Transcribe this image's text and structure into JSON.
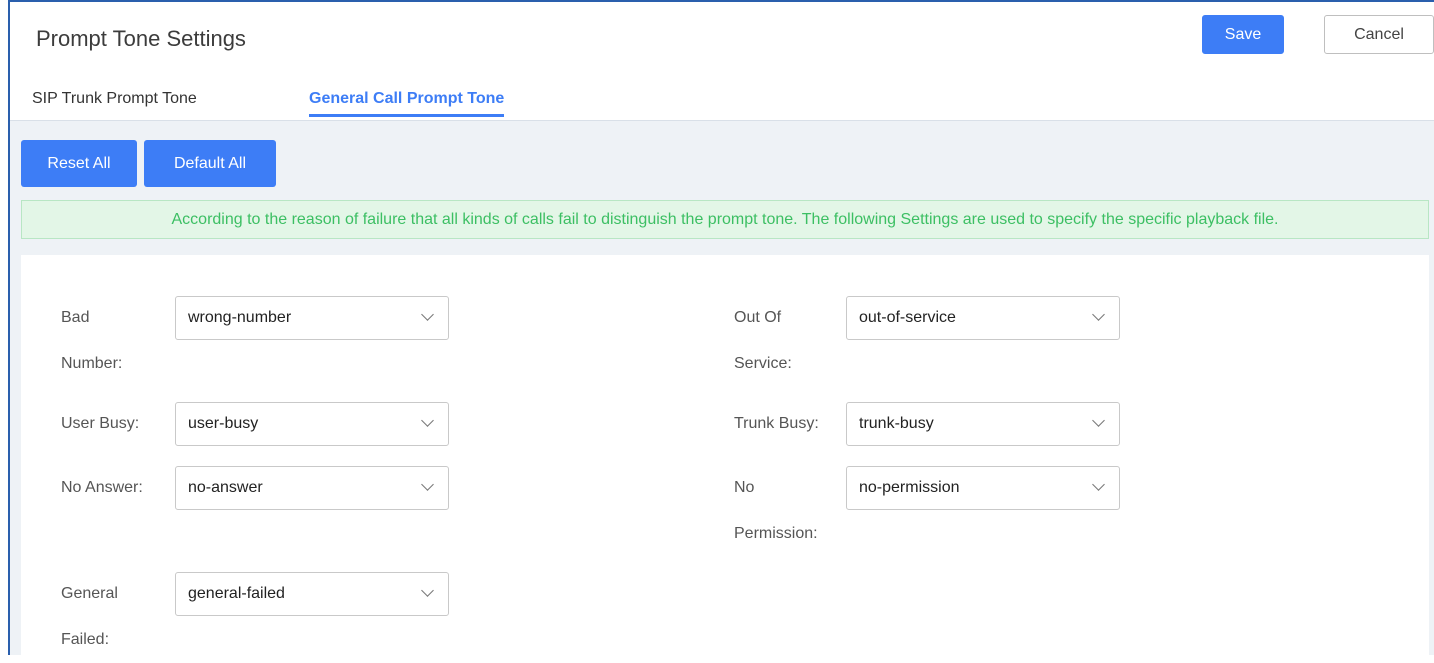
{
  "header": {
    "title": "Prompt Tone Settings",
    "save_label": "Save",
    "cancel_label": "Cancel"
  },
  "tabs": [
    {
      "label": "SIP Trunk Prompt Tone",
      "active": false
    },
    {
      "label": "General Call Prompt Tone",
      "active": true
    }
  ],
  "actions": {
    "reset_all": "Reset All",
    "default_all": "Default All"
  },
  "notice": "According to the reason of failure that all kinds of calls fail to distinguish the prompt tone. The following Settings are used to specify the specific playback file.",
  "fields": {
    "bad_number": {
      "label_line1": "Bad",
      "label_line2": "Number:",
      "value": "wrong-number"
    },
    "out_of_service": {
      "label_line1": "Out Of",
      "label_line2": "Service:",
      "value": "out-of-service"
    },
    "user_busy": {
      "label": "User Busy:",
      "value": "user-busy"
    },
    "trunk_busy": {
      "label": "Trunk Busy:",
      "value": "trunk-busy"
    },
    "no_answer": {
      "label": "No Answer:",
      "value": "no-answer"
    },
    "no_permission": {
      "label_line1": "No",
      "label_line2": "Permission:",
      "value": "no-permission"
    },
    "general_failed": {
      "label_line1": "General",
      "label_line2": "Failed:",
      "value": "general-failed"
    }
  },
  "colors": {
    "accent": "#3d7df6",
    "notice_text": "#3cbf63",
    "notice_bg": "#e3f6e7",
    "panel_bg": "#eef2f6"
  }
}
